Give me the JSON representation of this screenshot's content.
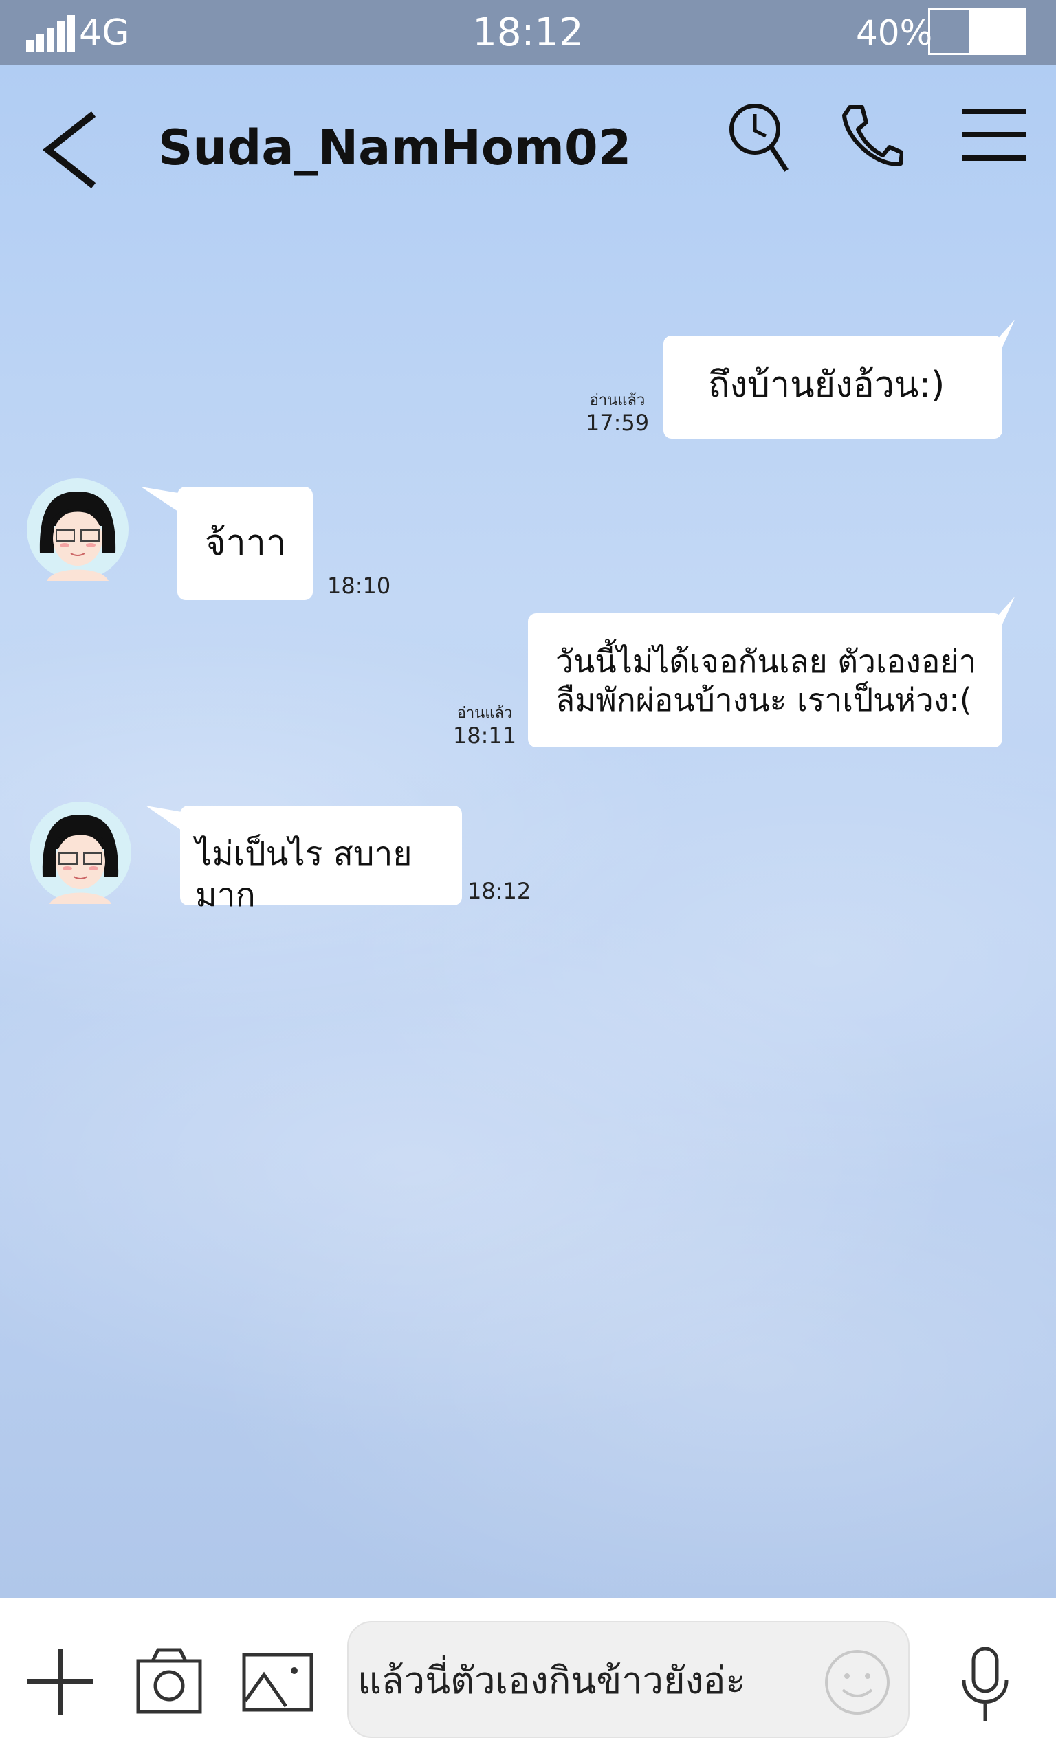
{
  "status_bar": {
    "network": "4G",
    "time": "18:12",
    "battery_percent": "40%",
    "battery_level": 0.4
  },
  "header": {
    "title": "Suda_NamHom02",
    "icons": [
      "back-arrow-icon",
      "history-clock-search-icon",
      "phone-icon",
      "menu-icon"
    ]
  },
  "messages": [
    {
      "side": "sent",
      "text": "ถึงบ้านยังอ้วน:)",
      "read_label": "อ่านแล้ว",
      "time": "17:59"
    },
    {
      "side": "received",
      "text": "จ้าาา",
      "time": "18:10"
    },
    {
      "side": "sent",
      "text_line1": "วันนี้ไม่ได้เจอกันเลย ตัวเองอย่า",
      "text_line2": "ลืมพักผ่อนบ้างนะ เราเป็นห่วง:(",
      "read_label": "อ่านแล้ว",
      "time": "18:11"
    },
    {
      "side": "received",
      "text": "ไม่เป็นไร สบายมาก",
      "time": "18:12"
    }
  ],
  "input_bar": {
    "value": "แล้วนี่ตัวเองกินข้าวยังอ่ะ",
    "icons": [
      "plus-icon",
      "camera-icon",
      "image-icon",
      "emoji-icon",
      "microphone-icon"
    ]
  },
  "colors": {
    "status_bar": "#8294b0",
    "bubble": "#ffffff",
    "bottom_bar": "#ffffff"
  }
}
